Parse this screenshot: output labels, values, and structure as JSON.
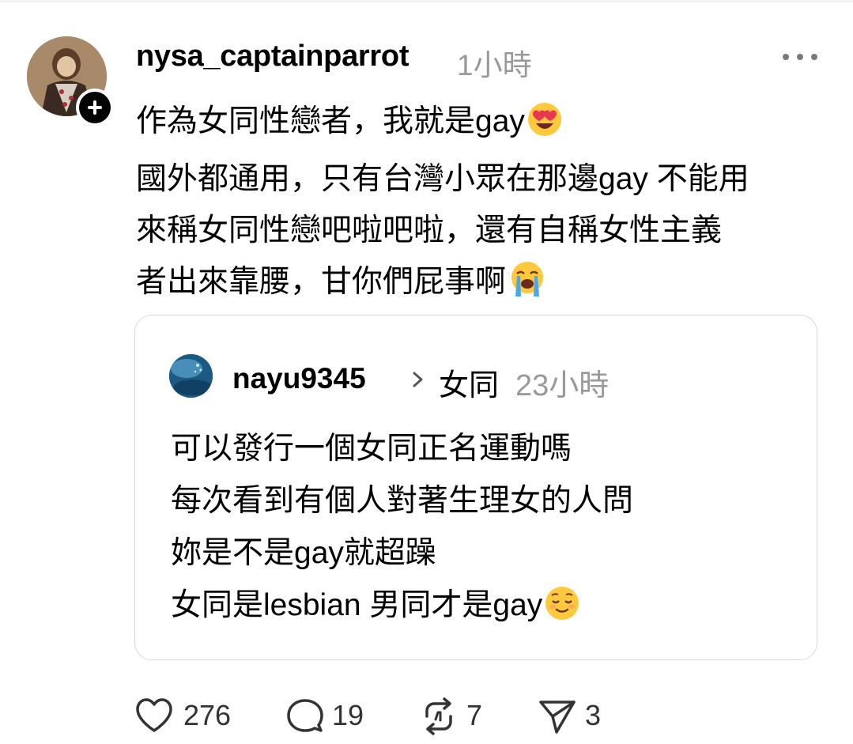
{
  "post": {
    "username": "nysa_captainparrot",
    "time": "1小時",
    "lines": [
      "作為女同性戀者，我就是gay",
      "國外都通用，只有台灣小眾在那邊gay 不能用",
      "來稱女同性戀吧啦吧啦，還有自稱女性主義",
      "者出來靠腰，甘你們屁事啊"
    ],
    "line1_emoji": "heart-eyes-emoji",
    "line4_emoji": "loudly-crying-emoji"
  },
  "quoted_post": {
    "username": "nayu9345",
    "topic": "女同",
    "time": "23小時",
    "lines": [
      "可以發行一個女同正名運動嗎",
      "每次看到有個人對著生理女的人問",
      "妳是不是gay就超躁",
      "女同是lesbian 男同才是gay"
    ],
    "line4_emoji": "relieved-emoji"
  },
  "actions": {
    "likes": "276",
    "replies": "19",
    "reposts": "7",
    "shares": "3"
  },
  "icons": {
    "follow": "plus-icon",
    "more": "more-options-icon",
    "like": "heart-icon",
    "reply": "comment-icon",
    "repost": "repost-icon",
    "share": "send-icon",
    "chevron": "chevron-right-icon"
  },
  "colors": {
    "text": "#000000",
    "muted": "#999999",
    "card_border": "#d9d9d9",
    "emoji_yellow": "#ffc83d",
    "heart_red": "#e8384f",
    "tear_blue": "#4aa8e8"
  }
}
